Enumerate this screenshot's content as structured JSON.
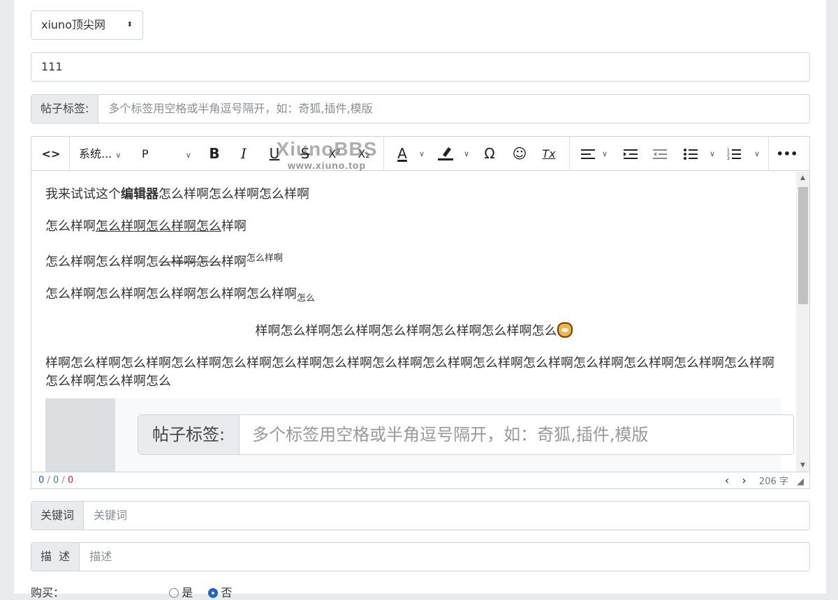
{
  "forum_select": {
    "value": "xiuno顶尖网",
    "caret": "⬍"
  },
  "title": {
    "value": "111"
  },
  "tags": {
    "label": "帖子标签:",
    "placeholder": "多个标签用空格或半角逗号隔开，如：奇狐,插件,模版"
  },
  "editor": {
    "toolbar": {
      "code": "<>",
      "font_family": "系统...",
      "paragraph": "P",
      "bold": "B",
      "italic": "I",
      "underline": "U",
      "strike": "S",
      "sup": "X²",
      "sub": "X₂",
      "text_color": "A",
      "omega": "Ω",
      "emoji": "☺",
      "clear_format": "Tx",
      "more": "•••",
      "chevron": "∨"
    },
    "watermark": {
      "logo": "XiunoBBS",
      "url": "www.xiuno.top"
    },
    "content": {
      "p1_a": "我来试试这个",
      "p1_bold": "编辑器",
      "p1_b": "怎么样啊怎么样啊怎么样啊",
      "p2_a": "怎么样啊",
      "p2_u": "怎么样啊怎么样啊怎么",
      "p2_b": "样啊",
      "p3_a": "怎么样啊怎么样啊怎",
      "p3_s": "么样啊怎么",
      "p3_b": "样啊",
      "p3_sup": "怎么样啊",
      "p4_a": "怎么样啊怎么样啊怎么样啊怎么样啊怎么样啊",
      "p4_sub": "怎么",
      "p5": "样啊怎么样啊怎么样啊怎么样啊怎么样啊怎么样啊怎么",
      "p6": "样啊怎么样啊怎么样啊怎么样啊怎么样啊怎么样啊怎么样啊怎么样啊怎么样啊怎么样啊怎么样啊怎么样啊怎么样啊怎么样啊怎么样啊怎么样啊怎么样啊怎么",
      "embedded_label": "帖子标签:",
      "embedded_placeholder": "多个标签用空格或半角逗号隔开，如：奇狐,插件,模版"
    },
    "status": {
      "count_blue": "0",
      "count_green": "0",
      "count_red": "0",
      "sep": "/",
      "prev": "‹",
      "next": "›",
      "word_count": "206 字"
    }
  },
  "keywords": {
    "label": "关键词",
    "placeholder": "关键词"
  },
  "description": {
    "label": "描  述",
    "placeholder": "描述"
  },
  "purchase": {
    "label": "购买：",
    "option_yes": "是",
    "option_no": "否"
  }
}
